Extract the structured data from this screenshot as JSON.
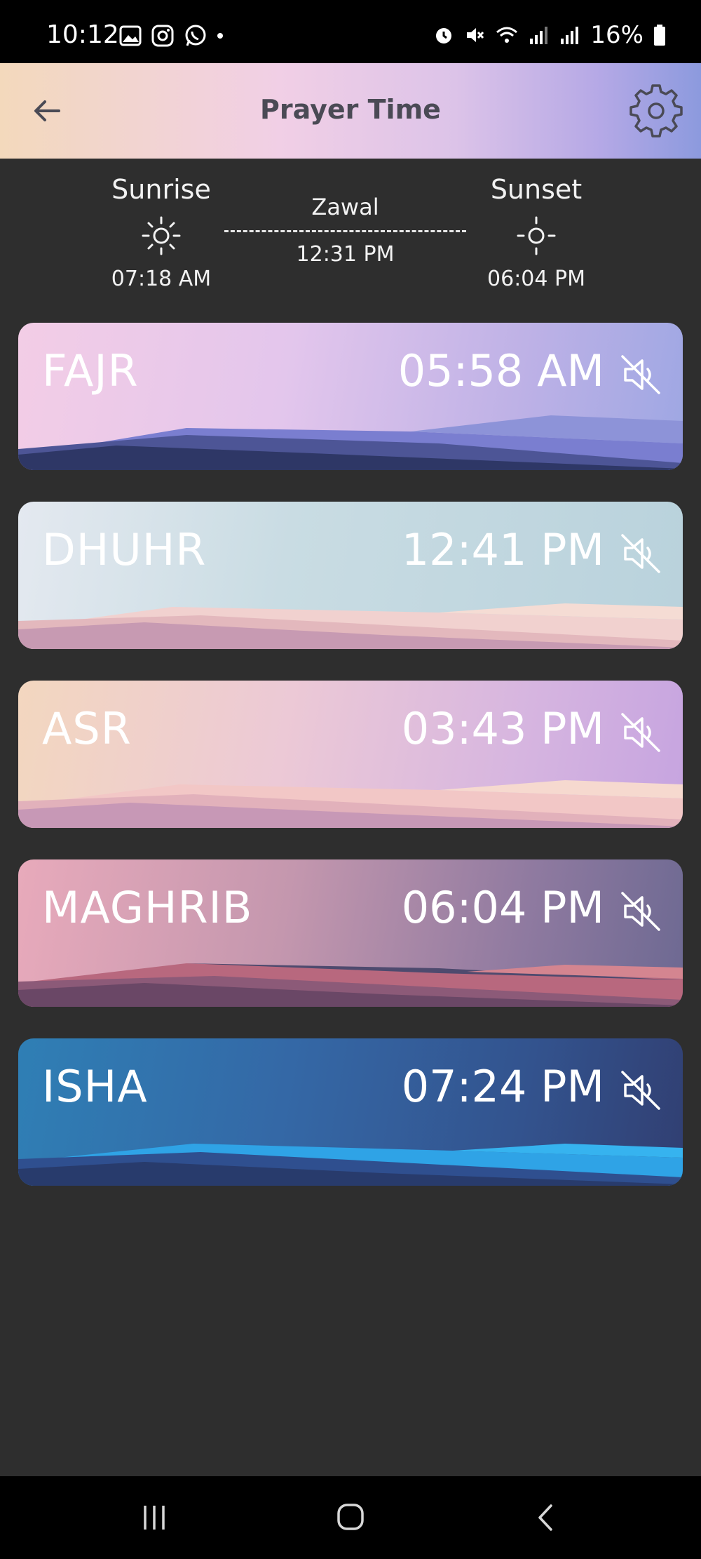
{
  "status_bar": {
    "time": "10:12",
    "battery": "16%",
    "left_icons": [
      "gallery-icon",
      "instagram-icon",
      "whatsapp-icon",
      "dot-icon"
    ],
    "right_icons": [
      "alarm-icon",
      "mute-icon",
      "wifi-icon",
      "signal-icon",
      "signal-icon",
      "battery-icon"
    ]
  },
  "header": {
    "title": "Prayer Time",
    "back_icon": "arrow-left-icon",
    "settings_icon": "gear-icon"
  },
  "sun_times": {
    "sunrise": {
      "label": "Sunrise",
      "time": "07:18 AM"
    },
    "zawal": {
      "label": "Zawal",
      "time": "12:31 PM"
    },
    "sunset": {
      "label": "Sunset",
      "time": "06:04 PM"
    }
  },
  "prayers": [
    {
      "name": "FAJR",
      "time": "05:58 AM",
      "muted": true
    },
    {
      "name": "DHUHR",
      "time": "12:41 PM",
      "muted": true
    },
    {
      "name": "ASR",
      "time": "03:43 PM",
      "muted": true
    },
    {
      "name": "MAGHRIB",
      "time": "06:04 PM",
      "muted": true
    },
    {
      "name": "ISHA",
      "time": "07:24 PM",
      "muted": true
    }
  ],
  "nav_bar": {
    "icons": [
      "recent-apps-icon",
      "home-icon",
      "back-icon"
    ]
  },
  "colors": {
    "background": "#2e2e2e",
    "header_title": "#4a4a55",
    "text": "#ffffff"
  }
}
